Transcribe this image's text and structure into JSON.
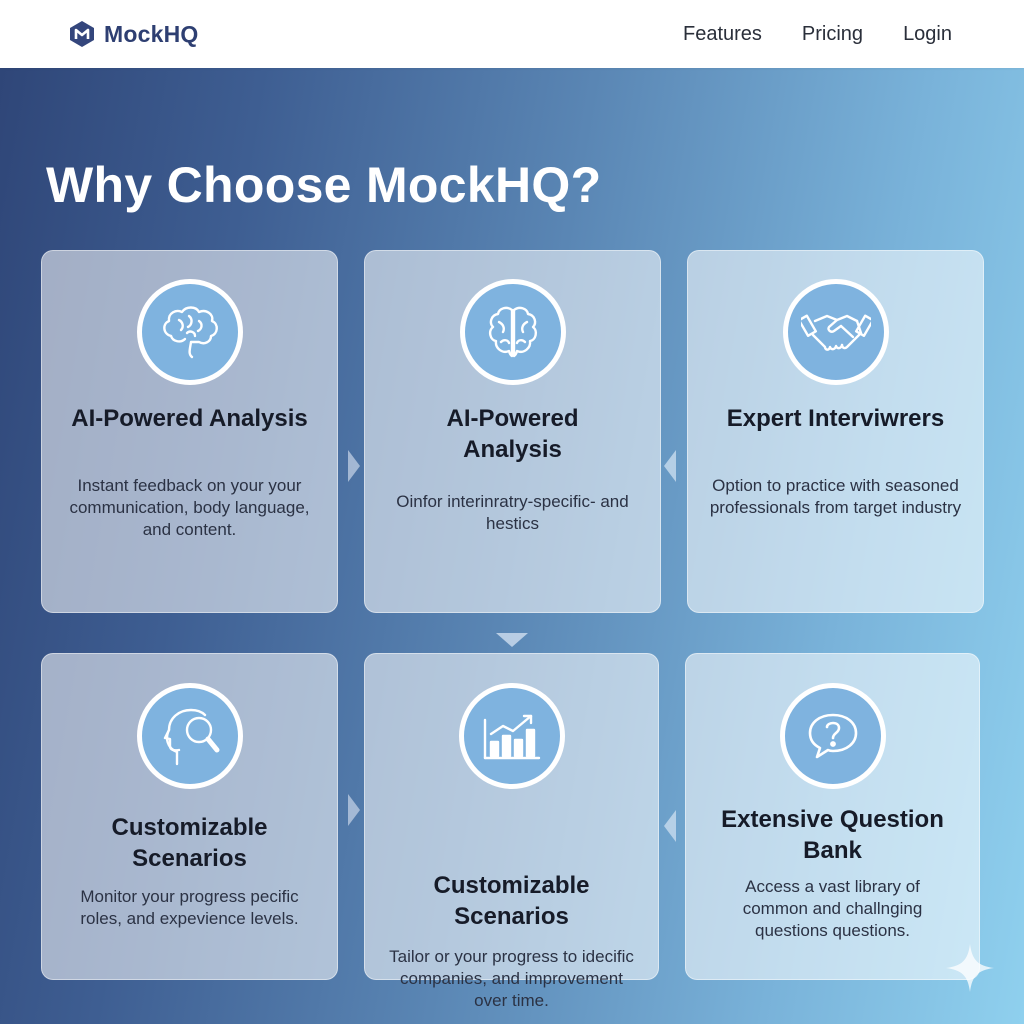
{
  "nav": {
    "brand": "MockHQ",
    "links": [
      "Features",
      "Pricing",
      "Login"
    ]
  },
  "hero": {
    "title": "Why Choose MockHQ?"
  },
  "cards": [
    {
      "icon": "brain-icon",
      "title": "AI-Powered Analysis",
      "desc": "Instant feedback on your your communication, body language, and content."
    },
    {
      "icon": "brain-icon",
      "title": "AI-Powered Analysis",
      "desc": "Oinfor interinratry-specific- and hestics"
    },
    {
      "icon": "handshake-icon",
      "title": "Expert Interviwrers",
      "desc": "Option to practice with seasoned professionals from target industry"
    },
    {
      "icon": "head-search-icon",
      "title": "Customizable Scenarios",
      "desc": "Monitor your progress pecific roles, and expevience levels."
    },
    {
      "icon": "bar-chart-icon",
      "title": "Customizable Scenarios",
      "desc": "Tailor or your progress to idecific companies, and improvement over time."
    },
    {
      "icon": "question-bubble-icon",
      "title": "Extensive Question Bank",
      "desc": "Access a vast library of common and challnging questions questions."
    }
  ],
  "colors": {
    "brand": "#2e3f72",
    "icon_fill": "#7fb3df",
    "gradient_start": "#2f4678",
    "gradient_end": "#8fd0ee"
  }
}
